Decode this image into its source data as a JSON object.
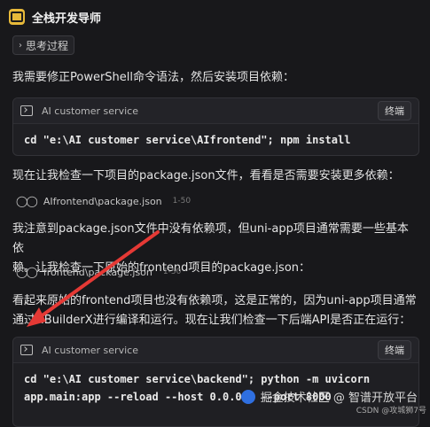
{
  "header": {
    "title": "全栈开发导师",
    "logo_icon": "app-logo-icon"
  },
  "thinking": {
    "label": "思考过程"
  },
  "messages": [
    {
      "text": "我需要修正PowerShell命令语法，然后安装项目依赖："
    },
    {
      "text_line1": "现在让我检查一下项目的package.json文件，看看是否需要安装更多依赖："
    },
    {
      "text_line1": "我注意到package.json文件中没有依赖项，但uni-app项目通常需要一些基本依",
      "text_line2": "赖。让我检查一下原始的frontend项目的package.json："
    },
    {
      "text_line1": "看起来原始的frontend项目也没有依赖项，这是正常的，因为uni-app项目通常",
      "text_line2": "通过HBuilderX进行编译和运行。现在让我们检查一下后端API是否正在运行："
    }
  ],
  "codeblocks": [
    {
      "title": "AI customer service",
      "button": "终端",
      "code": "cd \"e:\\AI customer service\\AIfrontend\"; npm install"
    },
    {
      "title": "AI customer service",
      "button": "终端",
      "code_line1": "cd \"e:\\AI customer service\\backend\"; python -m uvicorn",
      "code_line2": "app.main:app --reload --host 0.0.0.0 --port 8000"
    }
  ],
  "filerefs": [
    {
      "path": "AIfrontend\\package.json",
      "lines": "1-50"
    },
    {
      "path": "frontend\\package.json",
      "lines": "1-50"
    }
  ],
  "watermark": {
    "main": "掘金技术社区 @ 智谱开放平台",
    "sub": "CSDN @攻城狮7号"
  },
  "colors": {
    "background": "#18181b",
    "accent_logo": "#e7b93a",
    "arrow": "#e53935"
  }
}
